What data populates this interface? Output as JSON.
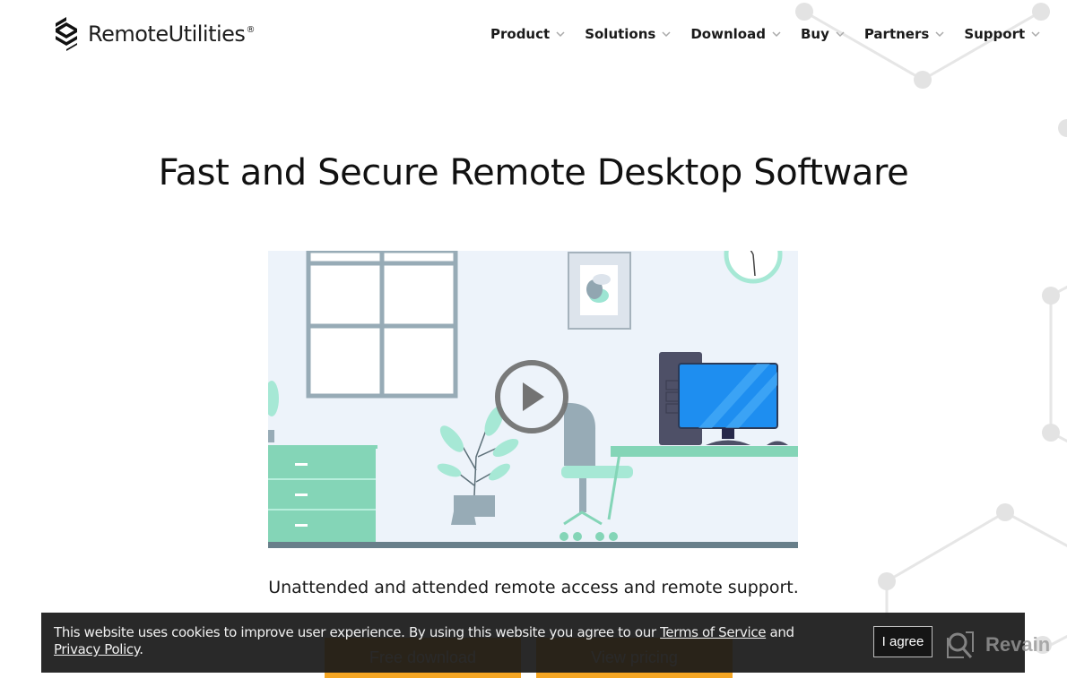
{
  "header": {
    "logo_text": "RemoteUtilities",
    "logo_reg": "®",
    "logo_icon": "remote-utilities-logo-icon",
    "nav": [
      {
        "label": "Product",
        "icon": "chevron-down-icon"
      },
      {
        "label": "Solutions",
        "icon": "chevron-down-icon"
      },
      {
        "label": "Download",
        "icon": "chevron-down-icon"
      },
      {
        "label": "Buy",
        "icon": "chevron-down-icon"
      },
      {
        "label": "Partners",
        "icon": "chevron-down-icon"
      },
      {
        "label": "Support",
        "icon": "chevron-down-icon"
      }
    ]
  },
  "hero": {
    "title": "Fast and Secure Remote Desktop Software",
    "video_icon": "play-icon",
    "subtitle": "Unattended and attended remote access and remote support.",
    "buttons": {
      "free_download": "Free download",
      "view_pricing": "View pricing"
    }
  },
  "cookie_banner": {
    "text_before": "This website uses cookies to improve user experience. By using this website you agree to our ",
    "terms_link": "Terms of Service",
    "text_middle": " and ",
    "privacy_link": "Privacy Policy",
    "text_after": ".",
    "agree_button": "I agree"
  },
  "watermark": {
    "text": "Revain",
    "icon": "revain-logo-icon"
  },
  "colors": {
    "cta": "#f5a623",
    "banner_bg": "#191919",
    "accent_green": "#84d5b7",
    "monitor_blue": "#2196f3"
  }
}
